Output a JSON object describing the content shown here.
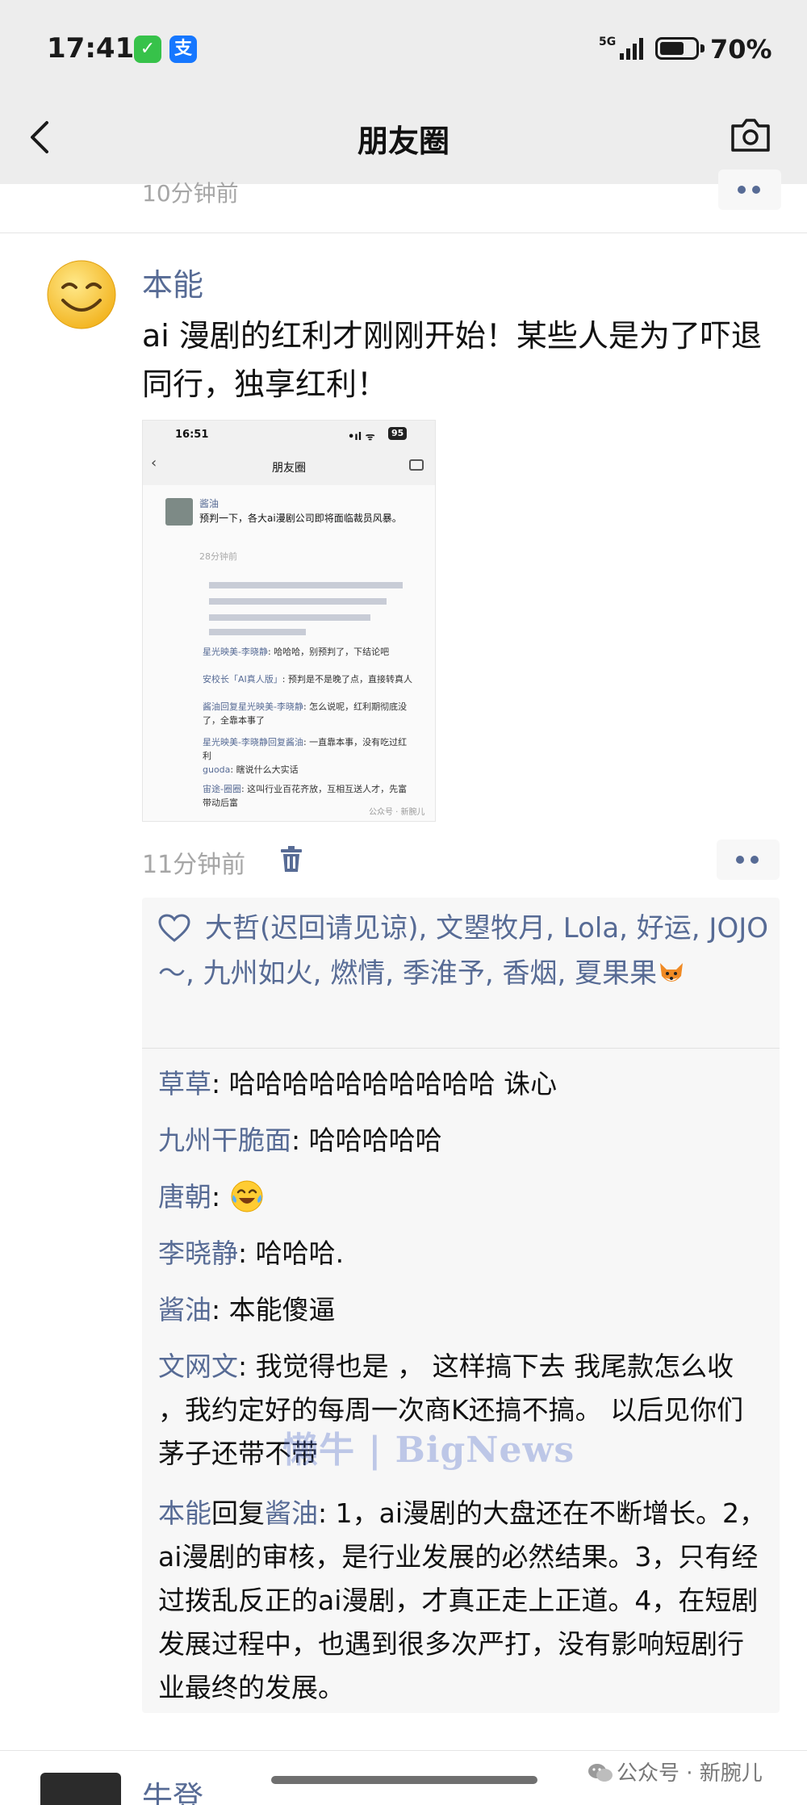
{
  "status_bar": {
    "time": "17:41",
    "wechat_glyph": "✓",
    "alipay_glyph": "支",
    "network": "5G",
    "battery_percent": "70%",
    "battery_level": 0.7
  },
  "header": {
    "title": "朋友圈",
    "back_icon": "chevron-left-icon",
    "camera_icon": "camera-icon"
  },
  "previous_post": {
    "time": "10分钟前"
  },
  "post": {
    "author": "本能",
    "text": "ai 漫剧的红利才刚刚开始！某些人是为了吓退同行，独享红利！",
    "time": "11分钟前",
    "embedded_screenshot": {
      "time": "16:51",
      "signal": "•ıl ᯤ",
      "battery": "95",
      "title": "朋友圈",
      "author": "酱油",
      "text": "预判一下，各大ai漫剧公司即将面临裁员风暴。",
      "ago": "28分钟前",
      "comments": [
        {
          "author": "星光映美-李晓静",
          "text": ": 哈哈哈，别预判了，下结论吧"
        },
        {
          "author": "安校长「AI真人版」",
          "text": ": 预判是不是晚了点，直接转真人"
        },
        {
          "author": "酱油回复星光映美-李晓静",
          "text": ": 怎么说呢，红利期彻底没了，全靠本事了"
        },
        {
          "author": "星光映美-李晓静回复酱油",
          "text": ": 一直靠本事，没有吃过红利"
        },
        {
          "author": "guoda",
          "text": ": 瞎说什么大实话"
        },
        {
          "author": "宙途-圈圈",
          "text": ": 这叫行业百花齐放，互相互送人才，先富带动后富"
        }
      ],
      "watermark": "公众号 · 新腕儿"
    },
    "likes": "大哲(迟回请见谅), 文曌牧月, Lola, 好运, JOJO～, 九州如火, 燃情, 季淮予, 香烟, 夏果果",
    "comments": [
      {
        "author": "草草",
        "text": ": 哈哈哈哈哈哈哈哈哈哈 诛心"
      },
      {
        "author": "九州干脆面",
        "text": ": 哈哈哈哈哈"
      },
      {
        "author": "唐朝",
        "text": ": "
      },
      {
        "author": "李晓静",
        "text": ": 哈哈哈."
      },
      {
        "author": "酱油",
        "text": ": 本能傻逼"
      },
      {
        "author": "文网文",
        "text": ": 我觉得也是 ， 这样搞下去 我尾款怎么收 ，我约定好的每周一次商K还搞不搞。 以后见你们 茅子还带不带"
      },
      {
        "author": "本能",
        "reply_word": "回复",
        "reply_to": "酱油",
        "text": ": 1，ai漫剧的大盘还在不断增长。2，ai漫剧的审核，是行业发展的必然结果。3，只有经过拨乱反正的ai漫剧，才真正走上正道。4，在短剧发展过程中，也遇到很多次严打，没有影响短剧行业最终的发展。"
      }
    ]
  },
  "overlay_watermark": "懒牛 | BigNews",
  "next_post": {
    "author": "牛登"
  },
  "source_tag": "公众号 · 新腕儿",
  "colors": {
    "link_blue": "#576b95",
    "top_bar_bg": "#ededed",
    "comment_bg": "#f7f7f7",
    "muted_text": "#a6a6a6"
  }
}
